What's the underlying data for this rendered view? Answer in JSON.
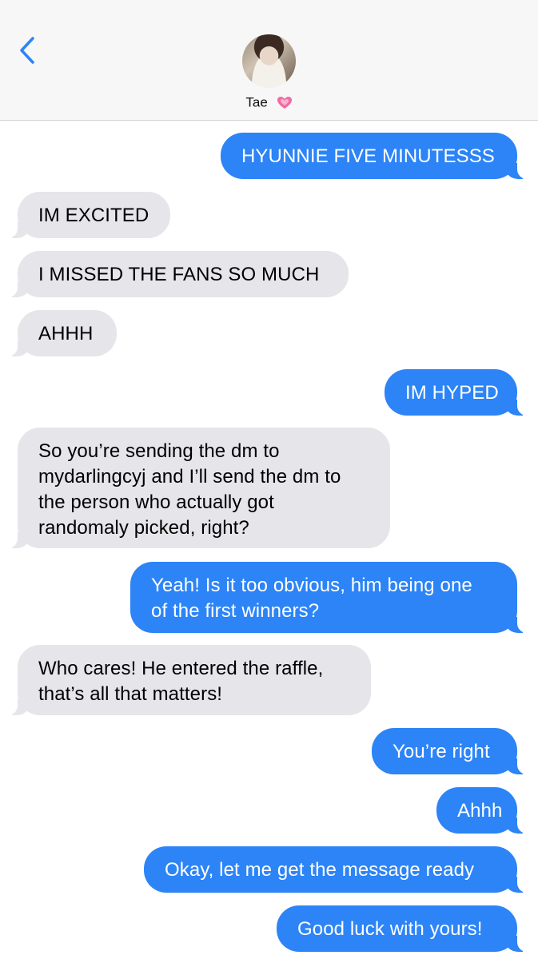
{
  "header": {
    "contact_name": "Tae",
    "heart_icon": "sparkling-heart-icon",
    "back_icon": "chevron-left-icon",
    "accent_color": "#2c84f7"
  },
  "messages": [
    {
      "from": "me",
      "text": "HYUNNIE FIVE MINUTESSS"
    },
    {
      "from": "them",
      "text": "IM EXCITED"
    },
    {
      "from": "them",
      "text": "I MISSED THE FANS SO MUCH"
    },
    {
      "from": "them",
      "text": "AHHH"
    },
    {
      "from": "me",
      "text": "IM HYPED"
    },
    {
      "from": "them",
      "text": "So you’re sending the dm to\nmydarlingcyj and I’ll send the dm to\nthe person who actually got\nrandomaly picked, right?"
    },
    {
      "from": "me",
      "text": "Yeah! Is it too obvious, him being one\nof the first winners?"
    },
    {
      "from": "them",
      "text": "Who cares! He entered the raffle,\nthat’s all that matters!"
    },
    {
      "from": "me",
      "text": "You’re right"
    },
    {
      "from": "me",
      "text": "Ahhh"
    },
    {
      "from": "me",
      "text": "Okay, let me get the message ready"
    },
    {
      "from": "me",
      "text": "Good luck with yours!"
    }
  ]
}
